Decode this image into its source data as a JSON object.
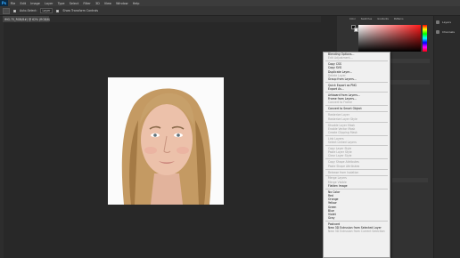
{
  "app": {
    "logo": "Ps"
  },
  "menubar": {
    "items": [
      "File",
      "Edit",
      "Image",
      "Layer",
      "Type",
      "Select",
      "Filter",
      "3D",
      "View",
      "Window",
      "Help"
    ]
  },
  "options": {
    "auto_select_label": "Auto-Select:",
    "auto_select_value": "Layer",
    "transform_label": "Show Transform Controls"
  },
  "document": {
    "tab_title": "IMG-75_RGB/8#) @ 62% (RGB/8)"
  },
  "panels": {
    "tabs": [
      "Color",
      "Swatches",
      "Gradients",
      "Patterns"
    ]
  },
  "side_panel": {
    "items": [
      "Layers",
      "Channels"
    ]
  },
  "colors": {
    "foreground": "#111111",
    "background": "#eeeeee"
  },
  "context_menu": {
    "groups": [
      [
        {
          "label": "Blending Options...",
          "enabled": true
        },
        {
          "label": "Edit Adjustment...",
          "enabled": false
        }
      ],
      [
        {
          "label": "Copy CSS",
          "enabled": true
        },
        {
          "label": "Copy SVG",
          "enabled": true
        },
        {
          "label": "Duplicate Layer...",
          "enabled": true
        },
        {
          "label": "Delete Layer",
          "enabled": false
        },
        {
          "label": "Group from Layers...",
          "enabled": true
        }
      ],
      [
        {
          "label": "Quick Export as PNG",
          "enabled": true
        },
        {
          "label": "Export As...",
          "enabled": true
        }
      ],
      [
        {
          "label": "Artboard from Layers...",
          "enabled": true
        },
        {
          "label": "Frame from Layers...",
          "enabled": true
        },
        {
          "label": "Convert to Frame",
          "enabled": false
        }
      ],
      [
        {
          "label": "Convert to Smart Object",
          "enabled": true
        }
      ],
      [
        {
          "label": "Rasterize Layer",
          "enabled": false
        },
        {
          "label": "Rasterize Layer Style",
          "enabled": false
        }
      ],
      [
        {
          "label": "Disable Layer Mask",
          "enabled": false
        },
        {
          "label": "Enable Vector Mask",
          "enabled": false
        },
        {
          "label": "Create Clipping Mask",
          "enabled": false
        }
      ],
      [
        {
          "label": "Link Layers",
          "enabled": false
        },
        {
          "label": "Select Linked Layers",
          "enabled": false
        }
      ],
      [
        {
          "label": "Copy Layer Style",
          "enabled": false
        },
        {
          "label": "Paste Layer Style",
          "enabled": false
        },
        {
          "label": "Clear Layer Style",
          "enabled": false
        }
      ],
      [
        {
          "label": "Copy Shape Attributes",
          "enabled": false
        },
        {
          "label": "Paste Shape Attributes",
          "enabled": false
        }
      ],
      [
        {
          "label": "Release from Isolation",
          "enabled": false
        }
      ],
      [
        {
          "label": "Merge Layers",
          "enabled": false
        },
        {
          "label": "Merge Visible",
          "enabled": false
        },
        {
          "label": "Flatten Image",
          "enabled": true
        }
      ],
      [
        {
          "label": "No Color",
          "enabled": true
        },
        {
          "label": "Red",
          "enabled": true
        },
        {
          "label": "Orange",
          "enabled": true
        },
        {
          "label": "Yellow",
          "enabled": true
        },
        {
          "label": "Green",
          "enabled": true
        },
        {
          "label": "Blue",
          "enabled": true
        },
        {
          "label": "Violet",
          "enabled": true
        },
        {
          "label": "Gray",
          "enabled": true
        }
      ],
      [
        {
          "label": "Postcard",
          "enabled": true
        },
        {
          "label": "New 3D Extrusion from Selected Layer",
          "enabled": true
        },
        {
          "label": "New 3D Extrusion from Current Selection",
          "enabled": false
        }
      ]
    ]
  }
}
